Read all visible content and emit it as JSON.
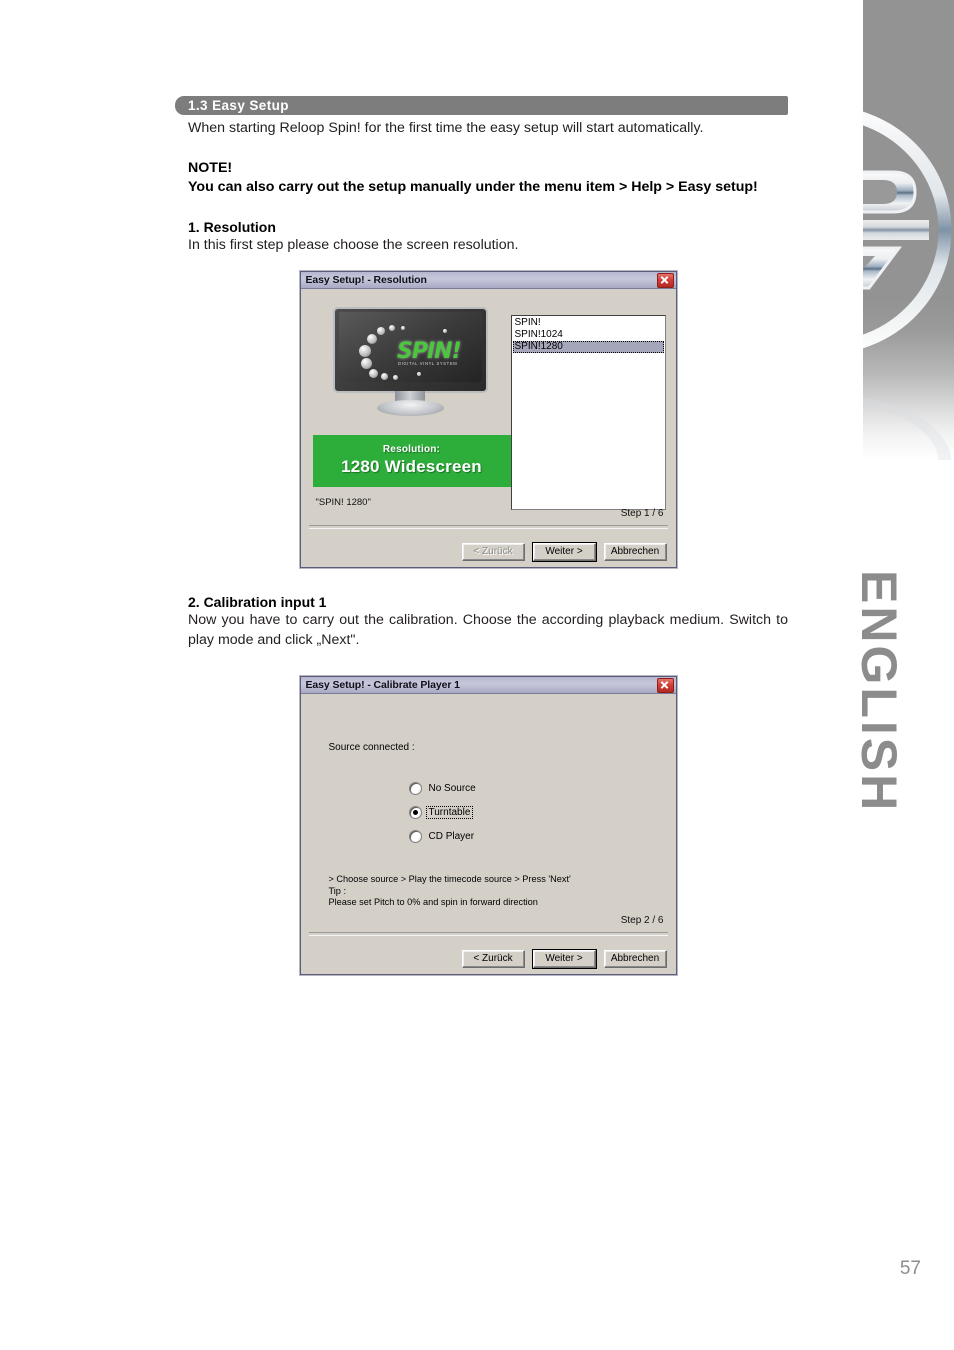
{
  "page": {
    "number": "57",
    "language_tab": "ENGLISH",
    "logo_name": "reloop-logo"
  },
  "section": {
    "bar_label": "1.3 Easy Setup",
    "intro": "When starting Reloop Spin! for the first time the easy setup will start automatically.",
    "note_head": "NOTE!",
    "note_body": "You can also carry out the setup manually under the menu item > Help > Easy setup!"
  },
  "step1": {
    "heading": "1. Resolution",
    "text": "In this first step please choose the screen resolution."
  },
  "step2": {
    "heading": "2. Calibration input 1",
    "text": "Now you have to carry out the calibration. Choose the according playback medium. Switch to play mode and click „Next\"."
  },
  "dialog1": {
    "title": "Easy Setup! - Resolution",
    "close_tooltip": "Close",
    "monitor": {
      "logo_word": "SPIN!",
      "logo_subtitle": "DIGITAL VINYL SYSTEM"
    },
    "banner": {
      "label": "Resolution:",
      "value": "1280 Widescreen"
    },
    "caption": "\"SPIN! 1280\"",
    "listbox": {
      "items": [
        "SPIN!",
        "SPIN!1024",
        "SPIN!1280"
      ],
      "selected_index": 2
    },
    "step_indicator": "Step 1 / 6",
    "buttons": {
      "back": "< Zurück",
      "back_accel": "Z",
      "next": "Weiter >",
      "next_accel": "W",
      "cancel": "Abbrechen"
    }
  },
  "dialog2": {
    "title": "Easy Setup! - Calibrate Player 1",
    "close_tooltip": "Close",
    "source_label": "Source connected :",
    "radios": [
      {
        "label": "No Source",
        "checked": false
      },
      {
        "label": "Turntable",
        "checked": true
      },
      {
        "label": "CD Player",
        "checked": false
      }
    ],
    "hint_line1": "> Choose source > Play the timecode source > Press 'Next'",
    "hint_line2": "Tip :",
    "hint_line3": "Please set Pitch to 0% and spin in forward direction",
    "step_indicator": "Step 2 / 6",
    "buttons": {
      "back": "< Zurück",
      "next": "Weiter >",
      "cancel": "Abbrechen"
    }
  },
  "colors": {
    "section_bar": "#7d7d7d",
    "banner_green": "#2dae3a",
    "spin_green": "#4dc63f",
    "dialog_face": "#d4d0c8",
    "titlebar": "#b6b6d0",
    "close_red": "#d03b34",
    "english_gray": "#8c8c8c"
  }
}
